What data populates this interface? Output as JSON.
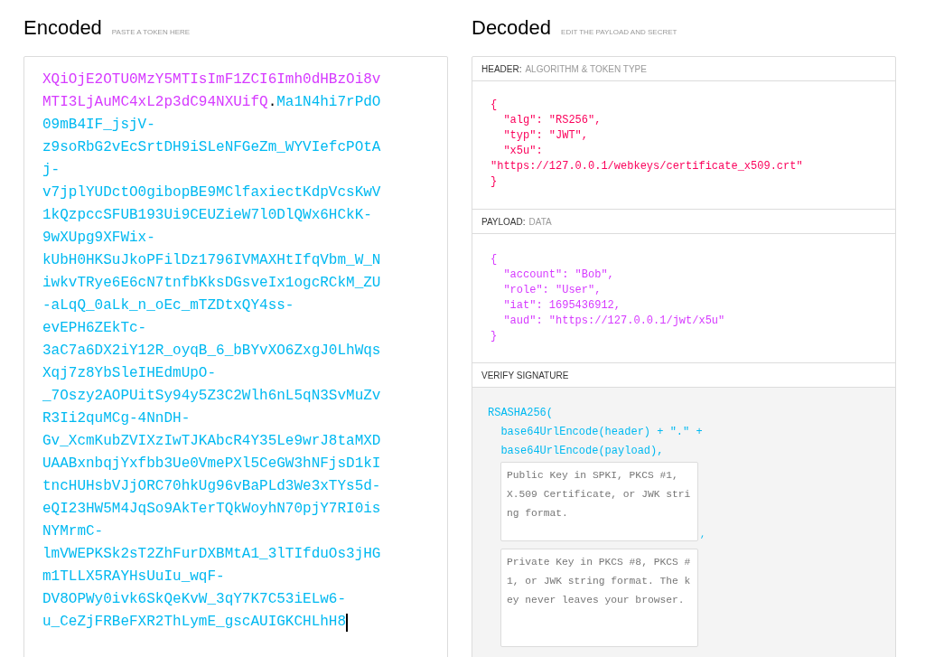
{
  "encoded": {
    "title": "Encoded",
    "hint": "PASTE A TOKEN HERE",
    "token_lines": [
      [
        {
          "kind": "payload",
          "text": "XQiOjE2OTU0MzY5MTIsImF1ZCI6Imh0dHBzOi8v"
        }
      ],
      [
        {
          "kind": "payload",
          "text": "MTI3LjAuMC4xL2p3dC94NXUifQ"
        },
        {
          "kind": "dot",
          "text": "."
        },
        {
          "kind": "signature",
          "text": "Ma1N4hi7rPdO"
        }
      ],
      [
        {
          "kind": "signature",
          "text": "09mB4IF_jsjV-"
        }
      ],
      [
        {
          "kind": "signature",
          "text": "z9soRbG2vEcSrtDH9iSLeNFGeZm_WYVIefcPOtA"
        }
      ],
      [
        {
          "kind": "signature",
          "text": "j-"
        }
      ],
      [
        {
          "kind": "signature",
          "text": "v7jplYUDctO0gibopBE9MClfaxiectKdpVcsKwV"
        }
      ],
      [
        {
          "kind": "signature",
          "text": "1kQzpccSFUB193Ui9CEUZieW7l0DlQWx6HCkK-"
        }
      ],
      [
        {
          "kind": "signature",
          "text": "9wXUpg9XFWix-"
        }
      ],
      [
        {
          "kind": "signature",
          "text": "kUbH0HKSuJkoPFilDz1796IVMAXHtIfqVbm_W_N"
        }
      ],
      [
        {
          "kind": "signature",
          "text": "iwkvTRye6E6cN7tnfbKksDGsveIx1ogcRCkM_ZU"
        }
      ],
      [
        {
          "kind": "signature",
          "text": "-aLqQ_0aLk_n_oEc_mTZDtxQY4ss-"
        }
      ],
      [
        {
          "kind": "signature",
          "text": "evEPH6ZEkTc-"
        }
      ],
      [
        {
          "kind": "signature",
          "text": "3aC7a6DX2iY12R_oyqB_6_bBYvXO6ZxgJ0LhWqs"
        }
      ],
      [
        {
          "kind": "signature",
          "text": "Xqj7z8YbSleIHEdmUpO-"
        }
      ],
      [
        {
          "kind": "signature",
          "text": "_7Oszy2AOPUitSy94y5Z3C2Wlh6nL5qN3SvMuZv"
        }
      ],
      [
        {
          "kind": "signature",
          "text": "R3Ii2quMCg-4NnDH-"
        }
      ],
      [
        {
          "kind": "signature",
          "text": "Gv_XcmKubZVIXzIwTJKAbcR4Y35Le9wrJ8taMXD"
        }
      ],
      [
        {
          "kind": "signature",
          "text": "UAABxnbqjYxfbb3Ue0VmePXl5CeGW3hNFjsD1kI"
        }
      ],
      [
        {
          "kind": "signature",
          "text": "tncHUHsbVJjORC70hkUg96vBaPLd3We3xTYs5d-"
        }
      ],
      [
        {
          "kind": "signature",
          "text": "eQI23HW5M4JqSo9AkTerTQkWoyhN70pjY7RI0is"
        }
      ],
      [
        {
          "kind": "signature",
          "text": "NYMrmC-"
        }
      ],
      [
        {
          "kind": "signature",
          "text": "lmVWEPKSk2sT2ZhFurDXBMtA1_3lTIfduOs3jHG"
        }
      ],
      [
        {
          "kind": "signature",
          "text": "m1TLLX5RAYHsUuIu_wqF-"
        }
      ],
      [
        {
          "kind": "signature",
          "text": "DV8OPWy0ivk6SkQeKvW_3qY7K7C53iELw6-"
        }
      ],
      [
        {
          "kind": "signature",
          "text": "u_CeZjFRBeFXR2ThLymE_gscAUIGKCHLhH8"
        }
      ]
    ]
  },
  "decoded": {
    "title": "Decoded",
    "hint": "EDIT THE PAYLOAD AND SECRET",
    "header": {
      "label": "HEADER:",
      "sublabel": "ALGORITHM & TOKEN TYPE",
      "lines": [
        "{",
        "  \"alg\": \"RS256\",",
        "  \"typ\": \"JWT\",",
        "  \"x5u\":",
        "\"https://127.0.0.1/webkeys/certificate_x509.crt\"",
        "}"
      ]
    },
    "payload": {
      "label": "PAYLOAD:",
      "sublabel": "DATA",
      "lines": [
        "{",
        "  \"account\": \"Bob\",",
        "  \"role\": \"User\",",
        "  \"iat\": 1695436912,",
        "  \"aud\": \"https://127.0.0.1/jwt/x5u\"",
        "}"
      ]
    },
    "verify": {
      "label": "VERIFY SIGNATURE",
      "lines": [
        "RSASHA256(",
        "  base64UrlEncode(header) + \".\" +",
        "  base64UrlEncode(payload),"
      ],
      "public_key": {
        "placeholder": "Public Key in SPKI, PKCS #1, X.509 Certificate, or JWK string format."
      },
      "separator": ",",
      "private_key": {
        "placeholder": "Private Key in PKCS #8, PKCS #1, or JWK string format. The key never leaves your browser."
      }
    }
  }
}
